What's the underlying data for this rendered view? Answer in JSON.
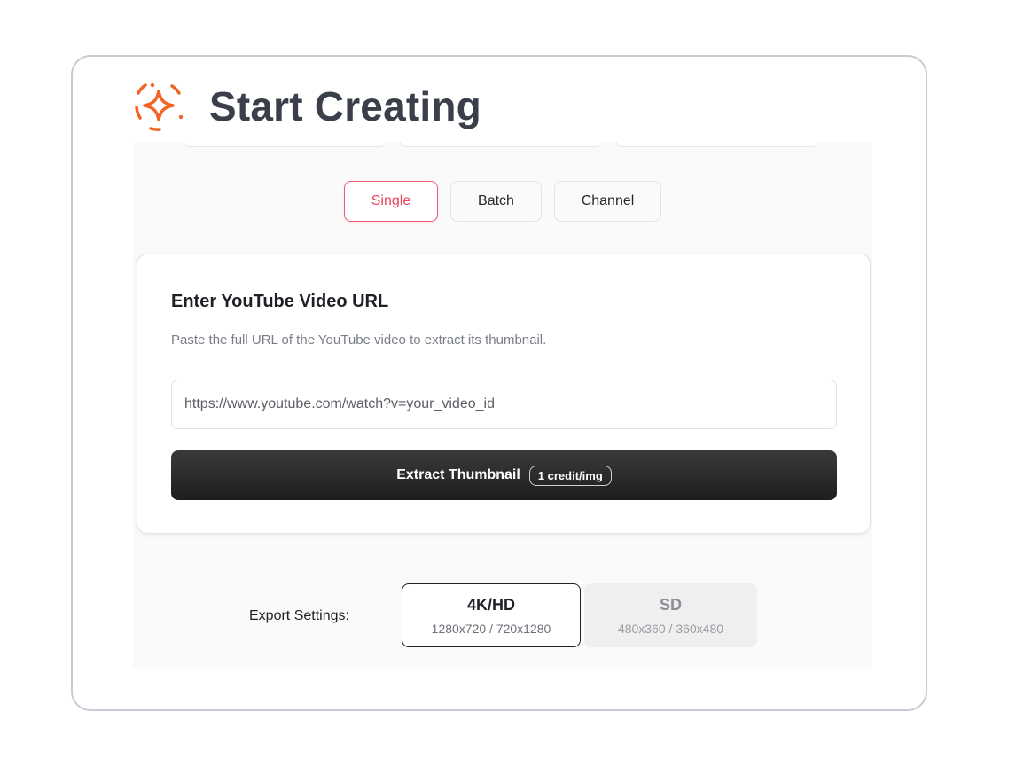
{
  "header": {
    "title": "Start Creating",
    "logo_icon": "sparkle-icon",
    "accent_color": "#f26522"
  },
  "tabs": [
    {
      "label": "Single",
      "active": true
    },
    {
      "label": "Batch",
      "active": false
    },
    {
      "label": "Channel",
      "active": false
    }
  ],
  "card": {
    "title": "Enter YouTube Video URL",
    "description": "Paste the full URL of the YouTube video to extract its thumbnail.",
    "url_placeholder": "https://www.youtube.com/watch?v=your_video_id",
    "extract_label": "Extract Thumbnail",
    "credit_badge": "1 credit/img"
  },
  "export": {
    "label": "Export Settings:",
    "options": [
      {
        "title": "4K/HD",
        "subtitle": "1280x720 / 720x1280",
        "selected": true
      },
      {
        "title": "SD",
        "subtitle": "480x360 / 360x480",
        "selected": false
      }
    ]
  },
  "colors": {
    "active_tab": "#e9435b",
    "button_bg": "#262626"
  }
}
